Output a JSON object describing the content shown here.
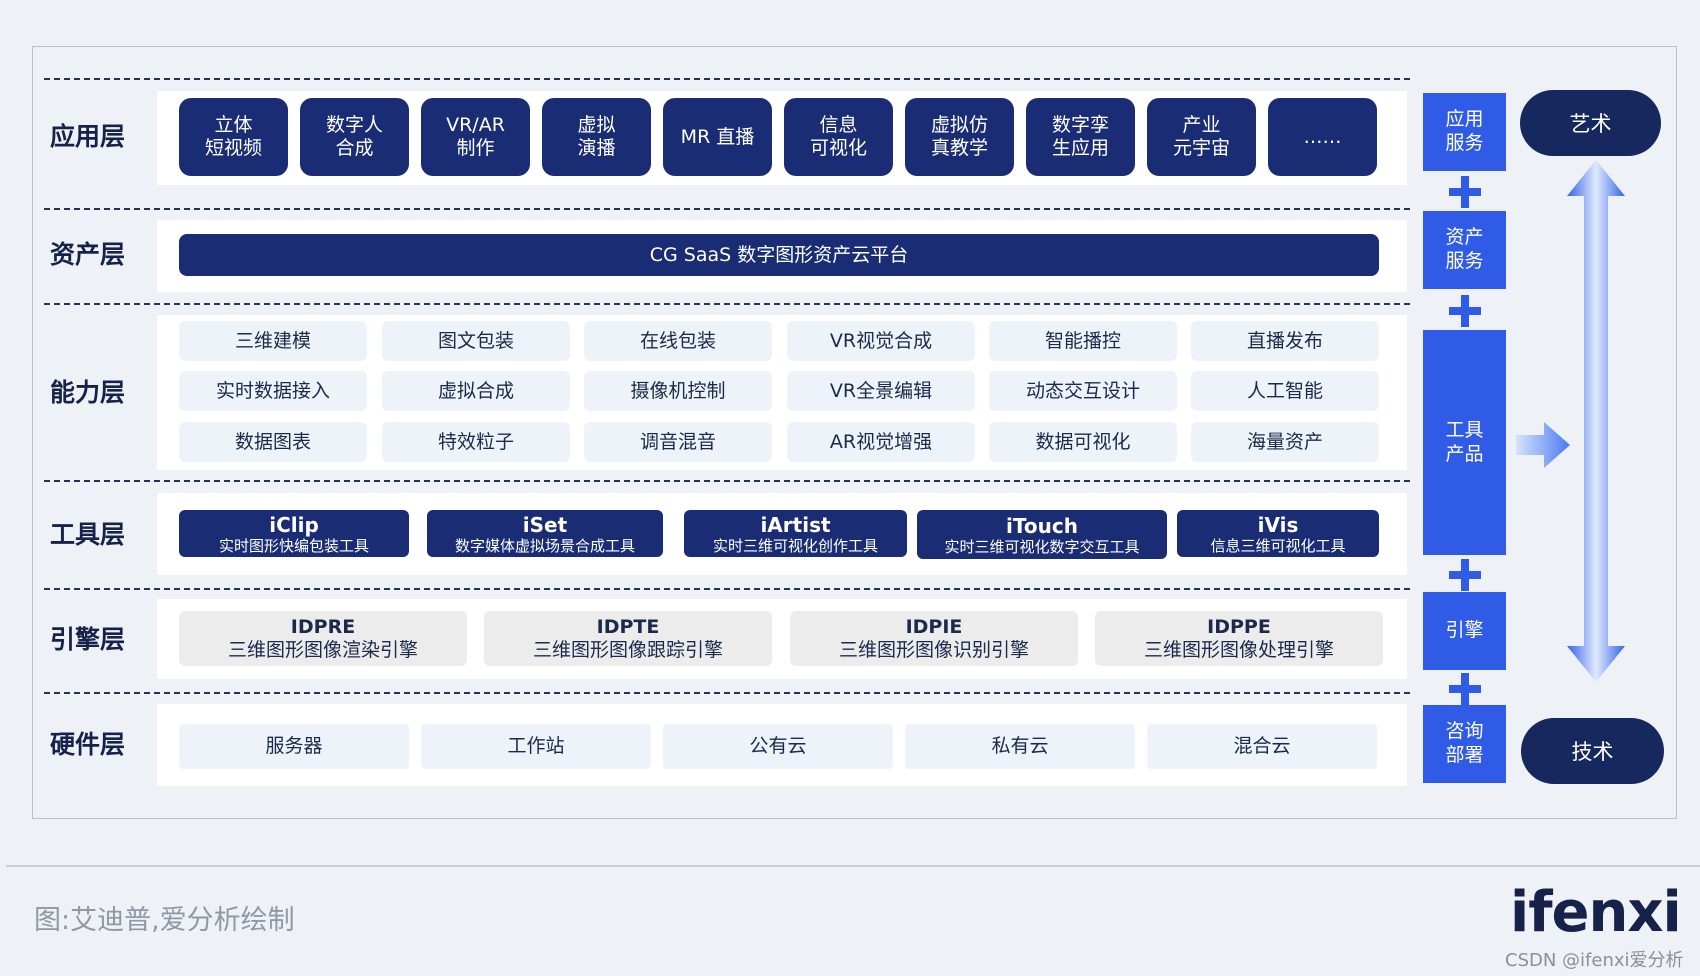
{
  "layers": {
    "app": "应用层",
    "asset": "资产层",
    "capability": "能力层",
    "tool": "工具层",
    "engine": "引擎层",
    "hardware": "硬件层"
  },
  "app_items": [
    {
      "line1": "立体",
      "line2": "短视频"
    },
    {
      "line1": "数字人",
      "line2": "合成"
    },
    {
      "line1": "VR/AR",
      "line2": "制作"
    },
    {
      "line1": "虚拟",
      "line2": "演播"
    },
    {
      "line1": "MR 直播",
      "line2": ""
    },
    {
      "line1": "信息",
      "line2": "可视化"
    },
    {
      "line1": "虚拟仿",
      "line2": "真教学"
    },
    {
      "line1": "数字孪",
      "line2": "生应用"
    },
    {
      "line1": "产业",
      "line2": "元宇宙"
    },
    {
      "line1": "……",
      "line2": ""
    }
  ],
  "asset_platform": "CG SaaS 数字图形资产云平台",
  "capabilities": [
    [
      "三维建模",
      "图文包装",
      "在线包装",
      "VR视觉合成",
      "智能播控",
      "直播发布"
    ],
    [
      "实时数据接入",
      "虚拟合成",
      "摄像机控制",
      "VR全景编辑",
      "动态交互设计",
      "人工智能"
    ],
    [
      "数据图表",
      "特效粒子",
      "调音混音",
      "AR视觉增强",
      "数据可视化",
      "海量资产"
    ]
  ],
  "tools": [
    {
      "name": "iClip",
      "desc": "实时图形快编包装工具"
    },
    {
      "name": "iSet",
      "desc": "数字媒体虚拟场景合成工具"
    },
    {
      "name": "iArtist",
      "desc": "实时三维可视化创作工具"
    },
    {
      "name": "iTouch",
      "desc": "实时三维可视化数字交互工具"
    },
    {
      "name": "iVis",
      "desc": "信息三维可视化工具"
    }
  ],
  "engines": [
    {
      "name": "IDPRE",
      "desc": "三维图形图像渲染引擎"
    },
    {
      "name": "IDPTE",
      "desc": "三维图形图像跟踪引擎"
    },
    {
      "name": "IDPIE",
      "desc": "三维图形图像识别引擎"
    },
    {
      "name": "IDPPE",
      "desc": "三维图形图像处理引擎"
    }
  ],
  "hardware": [
    "服务器",
    "工作站",
    "公有云",
    "私有云",
    "混合云"
  ],
  "side": {
    "app_service": "应用\n服务",
    "asset_service": "资产\n服务",
    "tool_product": "工具\n产品",
    "engine": "引擎",
    "consult": "咨询\n部署"
  },
  "ends": {
    "top": "艺术",
    "bottom": "技术"
  },
  "caption": "图:艾迪普,爱分析绘制",
  "logo": "ifenxi",
  "watermark": "CSDN @ifenxi爱分析",
  "colors": {
    "navy": "#1a2d74",
    "blue": "#2f5be6",
    "light": "#eef3fa"
  }
}
